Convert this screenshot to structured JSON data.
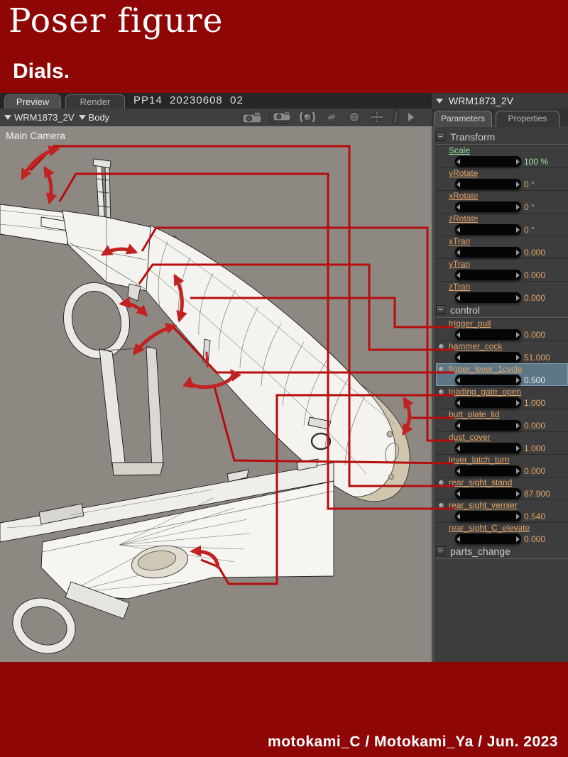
{
  "page": {
    "title": "Poser figure",
    "subtitle": "Dials.",
    "credit": "motokami_C / Motokami_Ya / Jun. 2023"
  },
  "tabs": {
    "preview": "Preview",
    "render": "Render",
    "document_title": "PP14  20230608  02"
  },
  "toolbar": {
    "figure": "WRM1873_2V",
    "actor": "Body",
    "icons": [
      "camera-main-icon",
      "camera-dolly-icon",
      "trackball-icon",
      "rotate-icon",
      "roll-icon",
      "translate-icon",
      "hand-icon",
      "expand-arrow-icon"
    ]
  },
  "viewport": {
    "camera_label": "Main Camera"
  },
  "panel": {
    "title": "WRM1873_2V",
    "tabs": [
      "Parameters",
      "Properties"
    ],
    "sections": [
      {
        "label": "Transform",
        "dials": [
          {
            "name": "Scale",
            "value": "100 %",
            "green": true
          },
          {
            "name": "yRotate",
            "value": "0 °"
          },
          {
            "name": "xRotate",
            "value": "0 °"
          },
          {
            "name": "zRotate",
            "value": "0 °"
          },
          {
            "name": "xTran",
            "value": "0.000"
          },
          {
            "name": "yTran",
            "value": "0.000"
          },
          {
            "name": "zTran",
            "value": "0.000"
          }
        ]
      },
      {
        "label": "control",
        "dials": [
          {
            "name": "trigger_pull",
            "value": "0.000"
          },
          {
            "name": "hammer_cock",
            "value": "51.000",
            "dot": true
          },
          {
            "name": "finger_lever_1cycle",
            "value": "0.500",
            "dot": true,
            "highlight": true
          },
          {
            "name": "loading_gate_open",
            "value": "1.000",
            "dot": true
          },
          {
            "name": "butt_plate_lid",
            "value": "0.000"
          },
          {
            "name": "dust_cover",
            "value": "1.000"
          },
          {
            "name": "lever_latch_turn",
            "value": "0.000"
          },
          {
            "name": "rear_sight_stand",
            "value": "87.900",
            "dot": true
          },
          {
            "name": "rear_sight_vernier",
            "value": "0.540",
            "dot": true
          },
          {
            "name": "rear_sight_C_elevate",
            "value": "0.000"
          }
        ]
      },
      {
        "label": "parts_change",
        "dials": []
      }
    ]
  },
  "colors": {
    "page_red": "#8e0606",
    "annotation_red": "#b60d0d",
    "arrow_red": "#c22222",
    "label_orange": "#e2a368",
    "label_green": "#9ce39c",
    "viewport_gray": "#8e8882",
    "highlight_blue": "#5d7787"
  }
}
